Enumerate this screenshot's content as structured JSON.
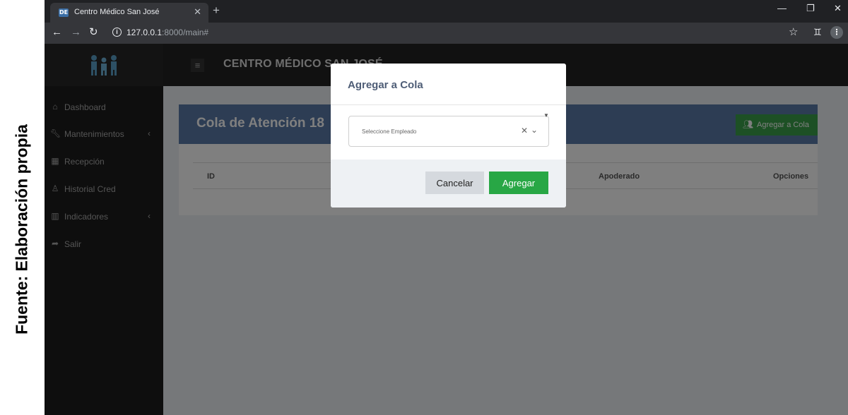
{
  "caption": "Fuente: Elaboración propia",
  "browser": {
    "tab_title": "Centro Médico San José",
    "favicon_text": "DE",
    "url_host": "127.0.0.1",
    "url_rest": ":8000/main#",
    "icons": [
      "close-icon",
      "new-tab-icon",
      "minimize-icon",
      "restore-icon",
      "back-icon",
      "forward-icon",
      "reload-icon",
      "info-icon",
      "star-icon",
      "incognito-icon",
      "menu-icon"
    ]
  },
  "app": {
    "brand_title": "CENTRO MÉDICO SAN JOSÉ",
    "sidebar": {
      "items": [
        {
          "label": "Dashboard",
          "icon": "home-icon"
        },
        {
          "label": "Mantenimientos",
          "icon": "wrench-icon",
          "has_submenu": true
        },
        {
          "label": "Recepción",
          "icon": "building-icon"
        },
        {
          "label": "Historial Cred",
          "icon": "user-icon"
        },
        {
          "label": "Indicadores",
          "icon": "bar-chart-icon",
          "has_submenu": true
        },
        {
          "label": "Salir",
          "icon": "sign-out-icon"
        }
      ]
    },
    "panel": {
      "title": "Cola de Atención 18",
      "add_button": "Agregar a Cola",
      "columns": [
        "ID",
        "Apoderado",
        "Opciones"
      ]
    }
  },
  "modal": {
    "title": "Agregar a Cola",
    "select_placeholder": "Seleccione Empleado",
    "cancel_label": "Cancelar",
    "submit_label": "Agregar"
  },
  "colors": {
    "sidebar_bg": "#1c1c1c",
    "panel_header": "#5a7aa8",
    "accent_green": "#28a745",
    "content_bg": "#ecf0f5"
  }
}
